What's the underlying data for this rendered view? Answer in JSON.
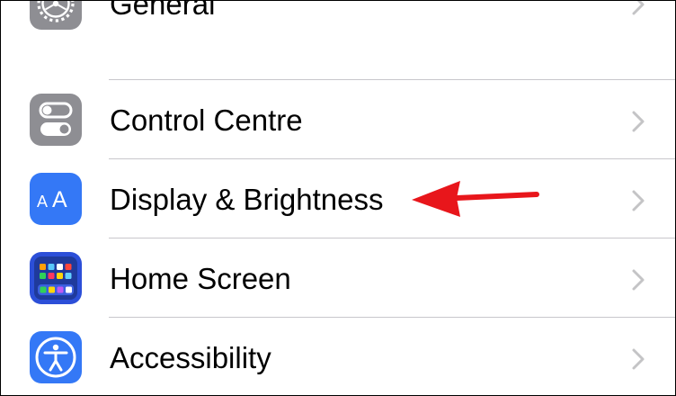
{
  "settings": {
    "items": [
      {
        "label": "General",
        "icon": "gear-icon",
        "icon_bg": "#8e8e93"
      },
      {
        "label": "Control Centre",
        "icon": "toggle-switches-icon",
        "icon_bg": "#8e8e93"
      },
      {
        "label": "Display & Brightness",
        "icon": "text-size-aa-icon",
        "icon_bg": "#3478f6"
      },
      {
        "label": "Home Screen",
        "icon": "app-grid-icon",
        "icon_bg": "#2c4fd8"
      },
      {
        "label": "Accessibility",
        "icon": "accessibility-person-icon",
        "icon_bg": "#3478f6"
      }
    ]
  },
  "annotation": {
    "arrow_color": "#e8161b",
    "points_to": "Display & Brightness"
  },
  "colors": {
    "chevron": "#c4c4c6",
    "divider": "#c8c7cc"
  }
}
